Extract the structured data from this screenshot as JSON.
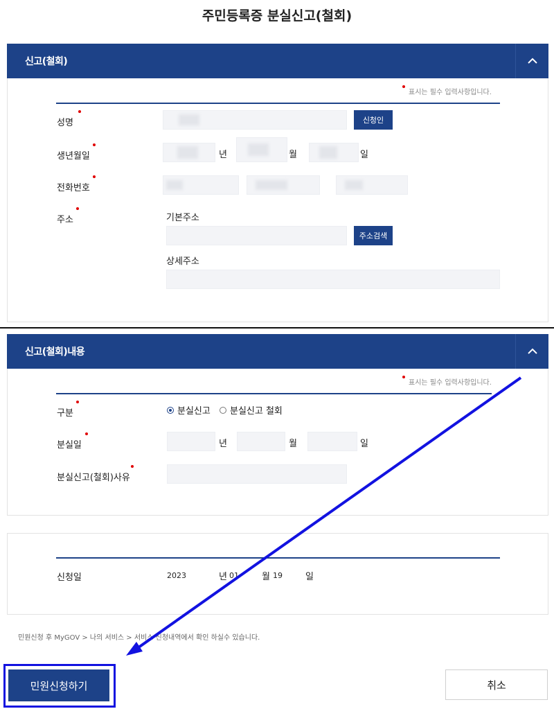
{
  "page_title": "주민등록증 분실신고(철회)",
  "required_note": "표시는 필수 입력사항입니다.",
  "section1": {
    "header": "신고(철회)",
    "name_label": "성명",
    "applicant_button": "신청인",
    "birth_label": "생년월일",
    "phone_label": "전화번호",
    "address_label": "주소",
    "basic_address_label": "기본주소",
    "address_search_button": "주소검색",
    "detail_address_label": "상세주소",
    "unit_year": "년",
    "unit_month": "월",
    "unit_day": "일"
  },
  "section2": {
    "header": "신고(철회)내용",
    "category_label": "구분",
    "radio_options": [
      "분실신고",
      "분실신고 철회"
    ],
    "selected_option": "분실신고",
    "lost_date_label": "분실일",
    "reason_label": "분실신고(철회)사유",
    "unit_year": "년",
    "unit_month": "월",
    "unit_day": "일"
  },
  "section3": {
    "application_date_label": "신청일",
    "year_value": "2023",
    "unit_year": "년",
    "month_value": "01",
    "unit_month": "월",
    "day_value": "19",
    "unit_day": "일"
  },
  "footnote": "민원신청 후 MyGOV > 나의 서비스 > 서비스 신청내역에서 확인 하실수 있습니다.",
  "buttons": {
    "submit": "민원신청하기",
    "cancel": "취소"
  },
  "icons": {
    "collapse": "chevron-up-icon",
    "annotation": "arrow-annotation-icon"
  },
  "colors": {
    "primary": "#1d4288",
    "required": "#e00000",
    "annotation": "#1212e0"
  }
}
